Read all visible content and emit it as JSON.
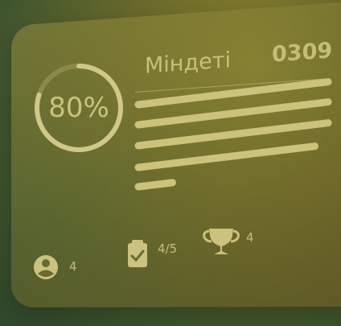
{
  "card": {
    "progress_percent": 80,
    "progress_label": "80%",
    "title": "Міндеті",
    "code": "0309"
  },
  "task_lines": [
    {
      "length_fraction": 1.0
    },
    {
      "length_fraction": 1.0
    },
    {
      "length_fraction": 1.0
    },
    {
      "length_fraction": 0.93
    },
    {
      "length_fraction": 0.18
    }
  ],
  "stats": {
    "users_icon": "user-circle-icon",
    "users_count": "4",
    "tasks_icon": "clipboard-check-icon",
    "tasks_count": "4/5",
    "trophy_icon": "trophy-icon",
    "trophy_count": "4"
  },
  "colors": {
    "accent": "#c8c07b",
    "ring_track": "#8b8a4a",
    "ring_fill": "#cfc888"
  }
}
